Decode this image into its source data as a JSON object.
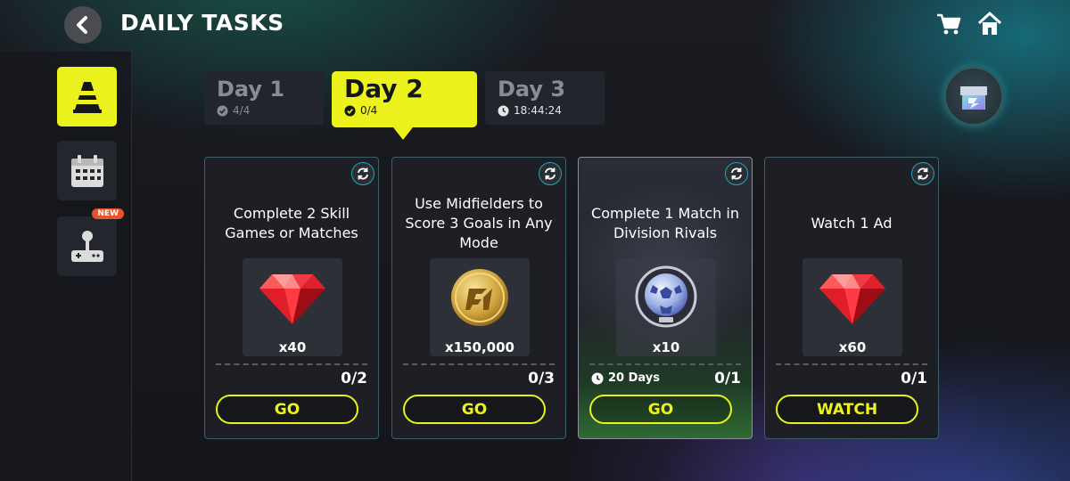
{
  "header": {
    "title": "DAILY TASKS",
    "back_icon": "chevron-left-icon",
    "cart_icon": "cart-icon",
    "home_icon": "home-icon"
  },
  "sidebar": {
    "items": [
      {
        "icon": "traffic-cone-icon",
        "active": true
      },
      {
        "icon": "calendar-icon",
        "active": false
      },
      {
        "icon": "joystick-icon",
        "active": false,
        "badge": "NEW"
      }
    ]
  },
  "days": [
    {
      "label": "Day 1",
      "status": "4/4",
      "status_icon": "check-circle-icon"
    },
    {
      "label": "Day 2",
      "status": "0/4",
      "status_icon": "check-circle-icon"
    },
    {
      "label": "Day 3",
      "status": "18:44:24",
      "status_icon": "clock-icon"
    }
  ],
  "tasks": [
    {
      "text": "Complete 2 Skill Games or Matches",
      "reward_icon": "ruby-gem-icon",
      "reward_qty": "x40",
      "progress": "0/2",
      "action": "GO"
    },
    {
      "text": "Use Midfielders to Score 3 Goals in Any Mode",
      "reward_icon": "gold-coin-icon",
      "reward_qty": "x150,000",
      "progress": "0/3",
      "action": "GO"
    },
    {
      "text": "Complete 1 Match in Division Rivals",
      "reward_icon": "soccer-ball-token-icon",
      "reward_qty": "x10",
      "duration": "20 Days",
      "progress": "0/1",
      "action": "GO"
    },
    {
      "text": "Watch 1 Ad",
      "reward_icon": "ruby-gem-icon",
      "reward_qty": "x60",
      "progress": "0/1",
      "action": "WATCH"
    }
  ],
  "colors": {
    "accent": "#ebf21e",
    "card_border": "#3b5f66",
    "badge": "#e8542a"
  }
}
